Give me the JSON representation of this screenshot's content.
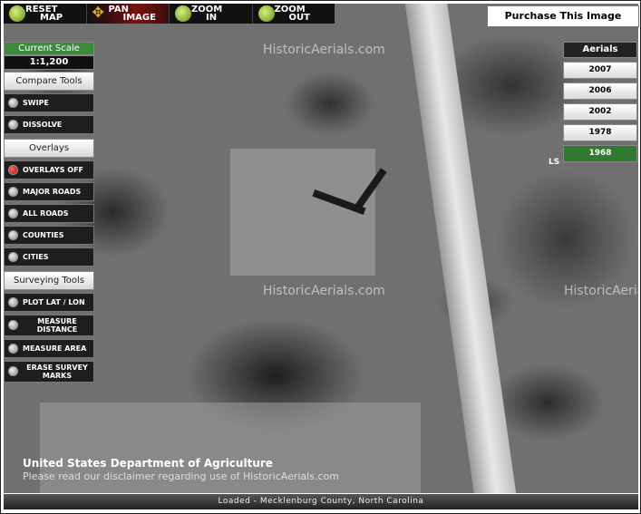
{
  "toolbar": {
    "reset": {
      "line1": "RESET",
      "line2": "MAP"
    },
    "pan": {
      "line1": "PAN",
      "line2": "IMAGE"
    },
    "zoom_in": {
      "line1": "ZOOM",
      "line2": "IN"
    },
    "zoom_out": {
      "line1": "ZOOM",
      "line2": "OUT"
    }
  },
  "purchase_label": "Purchase This Image",
  "scale": {
    "heading": "Current Scale",
    "value": "1:1,200"
  },
  "compare_tools": {
    "heading": "Compare Tools",
    "items": [
      "SWIPE",
      "DISSOLVE"
    ]
  },
  "overlays": {
    "heading": "Overlays",
    "items": [
      "OVERLAYS OFF",
      "MAJOR ROADS",
      "ALL ROADS",
      "COUNTIES",
      "CITIES"
    ],
    "selected": "OVERLAYS OFF"
  },
  "surveying_tools": {
    "heading": "Surveying Tools",
    "items": [
      "PLOT LAT / LON",
      "MEASURE DISTANCE",
      "MEASURE AREA",
      "ERASE SURVEY MARKS"
    ]
  },
  "aerials": {
    "heading": "Aerials",
    "years": [
      "2007",
      "2006",
      "2002",
      "1978",
      "1968"
    ],
    "selected": "1968"
  },
  "watermark": "HistoricAerials.com",
  "edge_label": "LS",
  "credits": {
    "agency": "United States Department of Agriculture",
    "disclaimer": "Please read our disclaimer regarding use of HistoricAerials.com"
  },
  "status": "Loaded - Mecklenburg County, North Carolina",
  "colors": {
    "active_green": "#2f7a2f",
    "scale_green": "#3c8a3c",
    "pan_red": "#7a1111"
  },
  "icons": {
    "reset": "globe-icon",
    "pan": "move-arrows-icon",
    "zoom_in": "magnifier-plus-icon",
    "zoom_out": "magnifier-minus-icon",
    "radio": "radio-button-icon"
  }
}
